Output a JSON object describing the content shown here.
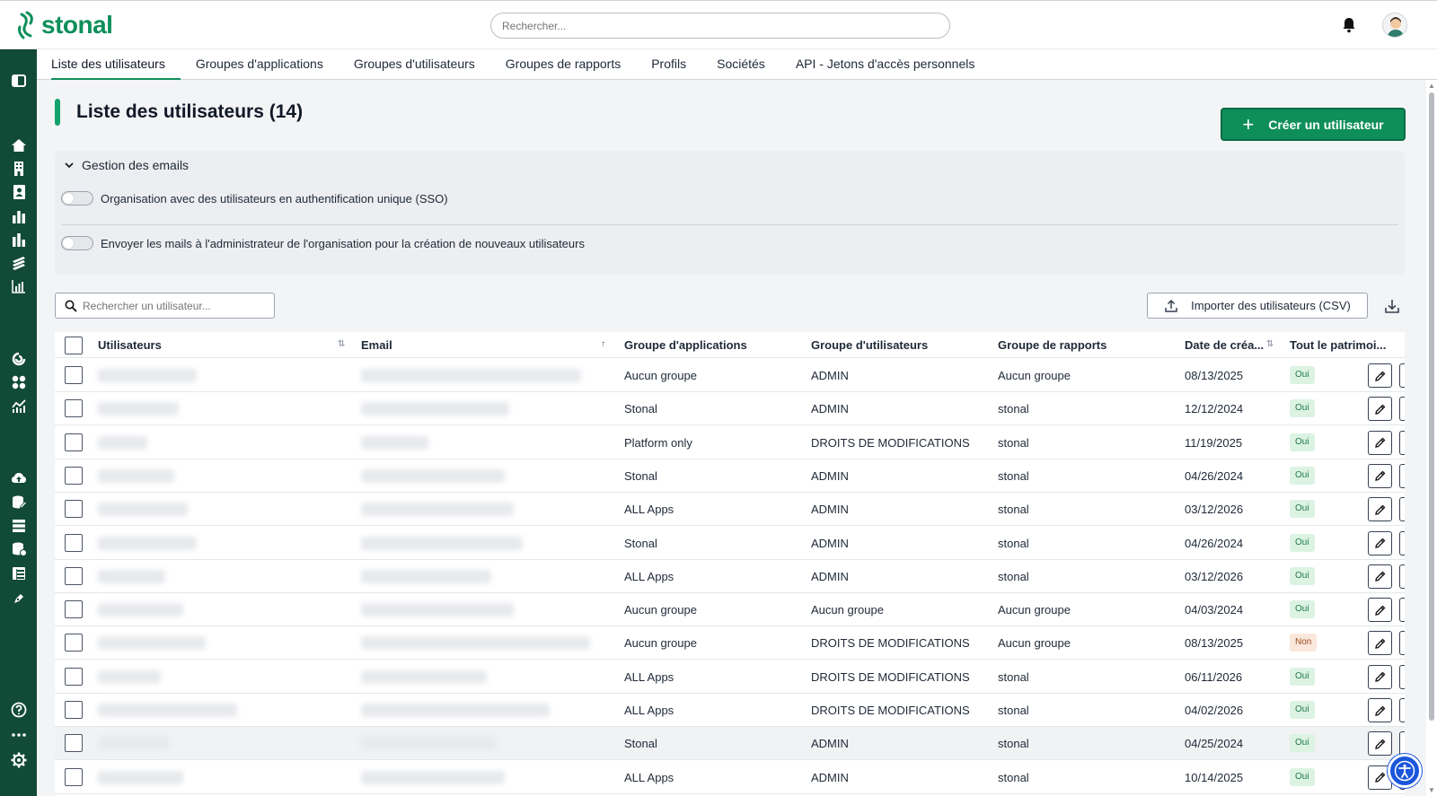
{
  "app": {
    "logo_text": "stonal",
    "brand_color": "#0e8f5a",
    "sidebar_color": "#124a38"
  },
  "header": {
    "search_placeholder": "Rechercher..."
  },
  "tabs": [
    {
      "label": "Liste des utilisateurs",
      "active": true
    },
    {
      "label": "Groupes d'applications"
    },
    {
      "label": "Groupes d'utilisateurs"
    },
    {
      "label": "Groupes de rapports"
    },
    {
      "label": "Profils"
    },
    {
      "label": "Sociétés"
    },
    {
      "label": "API - Jetons d'accès personnels"
    }
  ],
  "page": {
    "title": "Liste des utilisateurs (14)",
    "create_button": "Créer un utilisateur"
  },
  "email_panel": {
    "header": "Gestion des emails",
    "toggle_sso": "Organisation avec des utilisateurs en authentification unique (SSO)",
    "toggle_admin_mail": "Envoyer les mails à l'administrateur de l'organisation pour la création de nouveaux utilisateurs"
  },
  "toolbar": {
    "search_placeholder": "Rechercher un utilisateur...",
    "import_button": "Importer des utilisateurs (CSV)"
  },
  "table": {
    "columns": {
      "users": "Utilisateurs",
      "email": "Email",
      "app_group": "Groupe d'applications",
      "user_group": "Groupe d'utilisateurs",
      "report_group": "Groupe de rapports",
      "date": "Date de créa...",
      "all_assets": "Tout le patrimoi..."
    },
    "rows": [
      {
        "app_group": "Aucun groupe",
        "user_group": "ADMIN",
        "report_group": "Aucun groupe",
        "date": "08/13/2025",
        "all_assets": "Oui"
      },
      {
        "app_group": "Stonal",
        "user_group": "ADMIN",
        "report_group": "stonal",
        "date": "12/12/2024",
        "all_assets": "Oui"
      },
      {
        "app_group": "Platform only",
        "user_group": "DROITS DE MODIFICATIONS",
        "report_group": "stonal",
        "date": "11/19/2025",
        "all_assets": "Oui"
      },
      {
        "app_group": "Stonal",
        "user_group": "ADMIN",
        "report_group": "stonal",
        "date": "04/26/2024",
        "all_assets": "Oui"
      },
      {
        "app_group": "ALL Apps",
        "user_group": "ADMIN",
        "report_group": "stonal",
        "date": "03/12/2026",
        "all_assets": "Oui"
      },
      {
        "app_group": "Stonal",
        "user_group": "ADMIN",
        "report_group": "stonal",
        "date": "04/26/2024",
        "all_assets": "Oui"
      },
      {
        "app_group": "ALL Apps",
        "user_group": "ADMIN",
        "report_group": "stonal",
        "date": "03/12/2026",
        "all_assets": "Oui"
      },
      {
        "app_group": "Aucun groupe",
        "user_group": "Aucun groupe",
        "report_group": "Aucun groupe",
        "date": "04/03/2024",
        "all_assets": "Oui"
      },
      {
        "app_group": "Aucun groupe",
        "user_group": "DROITS DE MODIFICATIONS",
        "report_group": "Aucun groupe",
        "date": "08/13/2025",
        "all_assets": "Non"
      },
      {
        "app_group": "ALL Apps",
        "user_group": "DROITS DE MODIFICATIONS",
        "report_group": "stonal",
        "date": "06/11/2026",
        "all_assets": "Oui"
      },
      {
        "app_group": "ALL Apps",
        "user_group": "DROITS DE MODIFICATIONS",
        "report_group": "stonal",
        "date": "04/02/2026",
        "all_assets": "Oui"
      },
      {
        "app_group": "Stonal",
        "user_group": "ADMIN",
        "report_group": "stonal",
        "date": "04/25/2024",
        "all_assets": "Oui",
        "highlighted": true
      },
      {
        "app_group": "ALL Apps",
        "user_group": "ADMIN",
        "report_group": "stonal",
        "date": "10/14/2025",
        "all_assets": "Oui"
      }
    ]
  }
}
